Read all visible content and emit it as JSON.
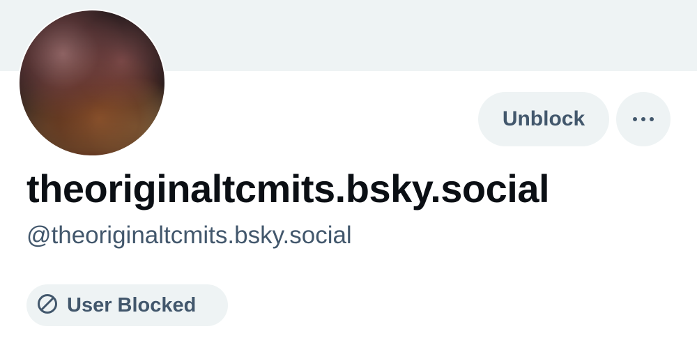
{
  "profile": {
    "display_name": "theoriginaltcmits.bsky.social",
    "handle": "@theoriginaltcmits.bsky.social",
    "avatar_icon": "avatar-image"
  },
  "actions": {
    "unblock_label": "Unblock",
    "more_icon": "more-dots-icon"
  },
  "status": {
    "blocked_label": "User Blocked",
    "blocked_icon": "block-icon"
  },
  "colors": {
    "banner": "#eef3f4",
    "pill_bg": "#eef3f4",
    "muted_text": "#42576c",
    "primary_text": "#0b0f14"
  }
}
